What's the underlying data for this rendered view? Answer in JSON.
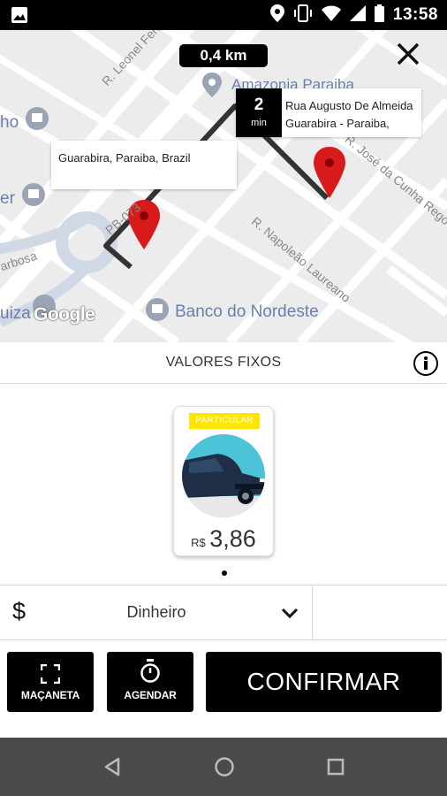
{
  "status_bar": {
    "time": "13:58",
    "icons": [
      "image-icon",
      "location-icon",
      "vibrate-icon",
      "wifi-icon",
      "signal-icon",
      "battery-icon"
    ]
  },
  "map": {
    "distance": "0,4 km",
    "eta": {
      "value": "2",
      "unit": "min"
    },
    "origin": {
      "address": "Guarabira, Paraiba, Brazil"
    },
    "destination": {
      "line1": "Rua Augusto De Almeida",
      "line2": "Guarabira - Paraiba,"
    },
    "street_labels": {
      "leonel": "R. Leonel Ferraz",
      "pb073": "PB-073",
      "jose_cunha": "R. José da Cunha Rego",
      "napoleao": "R. Napoleão Laureano",
      "arbosa": "arbosa"
    },
    "poi_labels": {
      "banco": "Banco do Nordeste",
      "amazonia": "Amazonia Paraiba",
      "ho": "ho",
      "er": "er",
      "uiza": "uiza"
    },
    "attribution": "Google",
    "colors": {
      "route": "#333333",
      "pin": "#d81a1a",
      "roads": "#ffffff",
      "land": "#ececec",
      "poi": "#6b7fae"
    }
  },
  "pricing": {
    "section_title": "VALORES FIXOS",
    "vehicle": {
      "badge": "PARTICULAR",
      "currency": "R$",
      "price": "3,86",
      "badge_color": "#ffe600",
      "avatar_color": "#4dc3d8"
    }
  },
  "payment": {
    "icon": "$",
    "method": "Dinheiro"
  },
  "actions": {
    "macaneta": "MAÇANETA",
    "agendar": "AGENDAR",
    "confirmar": "CONFIRMAR"
  }
}
